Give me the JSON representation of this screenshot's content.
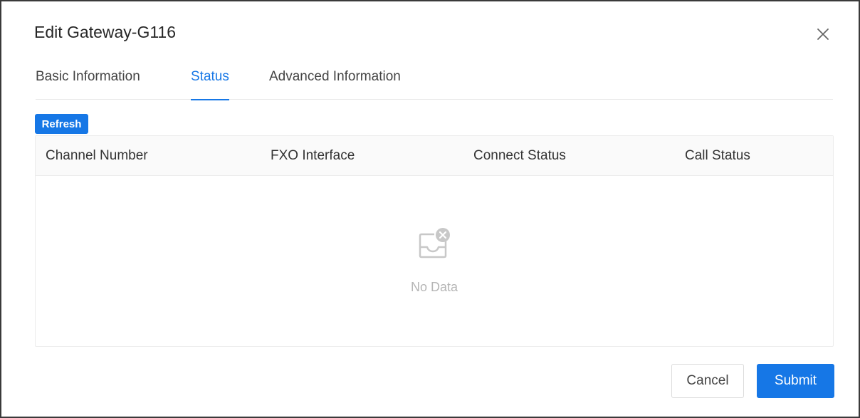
{
  "dialog": {
    "title": "Edit Gateway-G116",
    "close_icon": "close-icon"
  },
  "tabs": [
    {
      "label": "Basic Information",
      "active": false
    },
    {
      "label": "Status",
      "active": true
    },
    {
      "label": "Advanced Information",
      "active": false
    }
  ],
  "toolbar": {
    "refresh_label": "Refresh"
  },
  "table": {
    "columns": [
      "Channel Number",
      "FXO Interface",
      "Connect Status",
      "Call Status"
    ],
    "rows": [],
    "empty_icon": "empty-inbox-icon",
    "empty_text": "No Data"
  },
  "footer": {
    "cancel_label": "Cancel",
    "submit_label": "Submit"
  },
  "colors": {
    "accent": "#1677e6",
    "border": "#3a3a3a",
    "muted_text": "#b5b5b5"
  }
}
